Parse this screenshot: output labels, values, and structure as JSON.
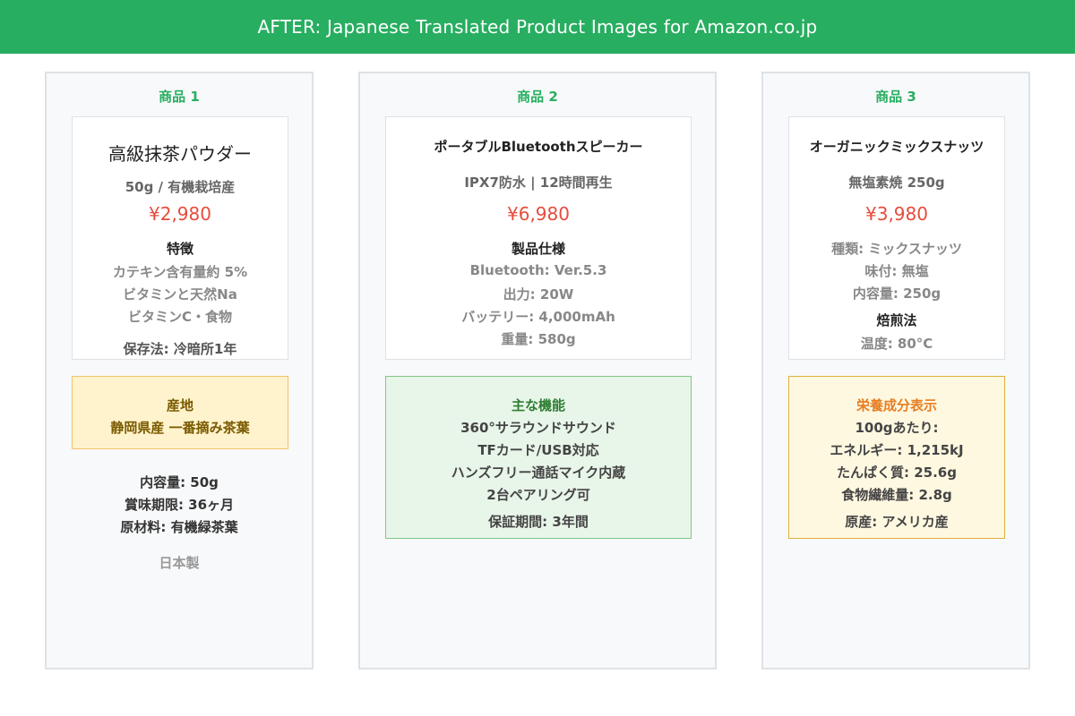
{
  "header": {
    "title": "AFTER: Japanese Translated Product Images for Amazon.co.jp"
  },
  "panels": [
    {
      "title": "商品 1",
      "card": {
        "name": "高級抹茶パウダー",
        "subtitle": "50g / 有機栽培産",
        "price": "¥2,980",
        "section_label": "特徴",
        "lines": [
          "カテキン含有量約 5%",
          "ビタミンと天然Na",
          "ビタミンC・食物"
        ],
        "footer": "保存法: 冷暗所1年"
      },
      "box": {
        "lines": [
          "産地",
          "静岡県産 一番摘み茶葉"
        ]
      },
      "below": [
        "内容量: 50g",
        "賞味期限: 36ヶ月",
        "原材料: 有機緑茶葉"
      ],
      "footnote": "日本製"
    },
    {
      "title": "商品 2",
      "card": {
        "name": "ポータブルBluetoothスピーカー",
        "subtitle": "IPX7防水 | 12時間再生",
        "price": "¥6,980",
        "section_label": "製品仕様",
        "lines": [
          "Bluetooth: Ver.5.3",
          "出力: 20W",
          "バッテリー: 4,000mAh",
          "重量: 580g"
        ]
      },
      "box": {
        "title": "主な機能",
        "lines": [
          "360°サラウンドサウンド",
          "TFカード/USB対応",
          "ハンズフリー通話マイク内蔵",
          "2台ペアリング可"
        ],
        "footer": "保証期間: 3年間"
      }
    },
    {
      "title": "商品 3",
      "card": {
        "name": "オーガニックミックスナッツ",
        "subtitle": "無塩素焼 250g",
        "price": "¥3,980",
        "lines": [
          "種類: ミックスナッツ",
          "味付: 無塩",
          "内容量: 250g"
        ],
        "section_label": "焙煎法",
        "footer": "温度: 80°C"
      },
      "box": {
        "title": "栄養成分表示",
        "lines": [
          "100gあたり:",
          "エネルギー: 1,215kJ",
          "たんぱく質: 25.6g",
          "食物繊維量: 2.8g"
        ],
        "footer": "原産: アメリカ産"
      }
    }
  ]
}
